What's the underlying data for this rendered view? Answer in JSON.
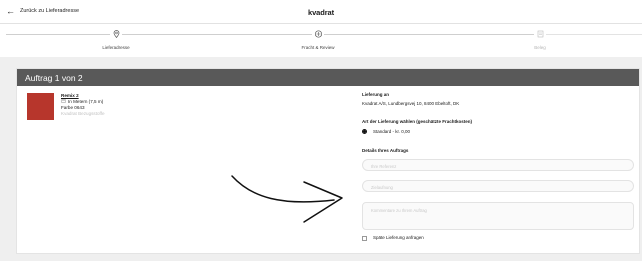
{
  "header": {
    "back_label": "Zurück zu Lieferadresse",
    "brand": "kvadrat"
  },
  "stepper": {
    "steps": [
      {
        "label": "Lieferadresse",
        "icon": "location-icon",
        "state": "done"
      },
      {
        "label": "Fracht & Review",
        "icon": "truck-icon",
        "state": "active"
      },
      {
        "label": "Beleg",
        "icon": "receipt-icon",
        "state": "upcoming"
      }
    ]
  },
  "order": {
    "title": "Auftrag 1 von 2",
    "product": {
      "name": "Remix 2",
      "quantity": "In Metern (7,5 m)",
      "color": "Farbe 0643",
      "category": "Kvadrat Bezugsstoffe",
      "swatch_color": "#b7362c"
    },
    "delivery": {
      "heading": "Lieferung an",
      "address": "Kvadrat A/S, Lundbergsvej 10, 8400 Ebeltoft, DK",
      "method_heading": "Art der Lieferung wählen (geschätzte Frachtkosten)",
      "method_option": "Standard - kr. 0,00",
      "details_heading": "Details Ihres Auftrags",
      "reference_placeholder": "Ihre Referenz",
      "label_placeholder": "Zielaufnung",
      "comment_placeholder": "Kommentare zu Ihrem Auftrag",
      "late_delivery_label": "Späte Lieferung anfragen"
    }
  }
}
